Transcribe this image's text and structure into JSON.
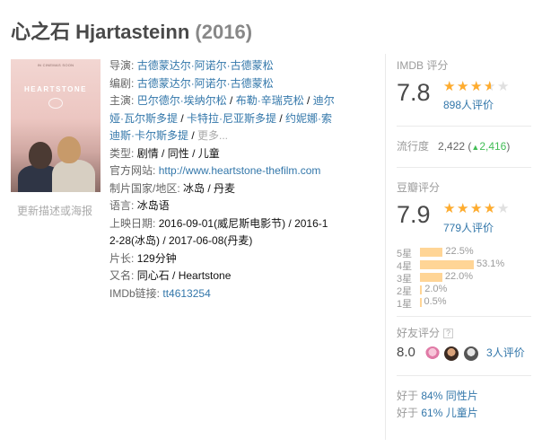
{
  "header": {
    "title_cn": "心之石",
    "title_en": "Hjartasteinn",
    "year": "(2016)"
  },
  "poster": {
    "top_text": "IN CINEMAS SOON",
    "title_text": "HEARTSTONE",
    "update_link": "更新描述或海报"
  },
  "info": {
    "director_label": "导演",
    "director": "古德蒙达尔·阿诺尔·古德蒙松",
    "writer_label": "编剧",
    "writer": "古德蒙达尔·阿诺尔·古德蒙松",
    "cast_label": "主演",
    "cast": [
      "巴尔德尔·埃纳尔松",
      "布勒·辛瑞克松",
      "迪尔娅·瓦尔斯多提",
      "卡特拉·尼亚斯多提",
      "约妮娜·索迪斯·卡尔斯多提"
    ],
    "cast_more": "更多...",
    "genre_label": "类型:",
    "genres": [
      "剧情",
      "同性",
      "儿童"
    ],
    "website_label": "官方网站:",
    "website": "http://www.heartstone-thefilm.com",
    "country_label": "制片国家/地区:",
    "country": "冰岛 / 丹麦",
    "language_label": "语言:",
    "language": "冰岛语",
    "release_label": "上映日期:",
    "release_line1": "2016-09-01(威尼斯电影节) / 2016-1",
    "release_line2": "2-28(冰岛) / 2017-06-08(丹麦)",
    "runtime_label": "片长:",
    "runtime": "129分钟",
    "aka_label": "又名:",
    "aka": "同心石 / Heartstone",
    "imdb_label": "IMDb链接:",
    "imdb": "tt4613254"
  },
  "imdb_rating": {
    "label": "IMDB 评分",
    "score": "7.8",
    "stars": 3.5,
    "votes": "898人评价"
  },
  "popularity": {
    "label": "流行度",
    "value": "2,422",
    "change": "2,416",
    "arrow": "▲"
  },
  "douban_rating": {
    "label": "豆瓣评分",
    "score": "7.9",
    "stars": 4,
    "votes": "779人评价",
    "distribution": [
      {
        "label": "5星",
        "pct": "22.5%",
        "value": 22.5
      },
      {
        "label": "4星",
        "pct": "53.1%",
        "value": 53.1
      },
      {
        "label": "3星",
        "pct": "22.0%",
        "value": 22.0
      },
      {
        "label": "2星",
        "pct": "2.0%",
        "value": 2.0
      },
      {
        "label": "1星",
        "pct": "0.5%",
        "value": 0.5
      }
    ]
  },
  "friends": {
    "label": "好友评分",
    "help": "?",
    "score": "8.0",
    "votes": "3人评价"
  },
  "better_than": [
    {
      "prefix": "好于 ",
      "link": "84% 同性片"
    },
    {
      "prefix": "好于 ",
      "link": "61% 儿童片"
    }
  ],
  "colors": {
    "link": "#3377aa",
    "star": "#ffac2d",
    "bar": "#ffd596",
    "up": "#42bd56"
  }
}
